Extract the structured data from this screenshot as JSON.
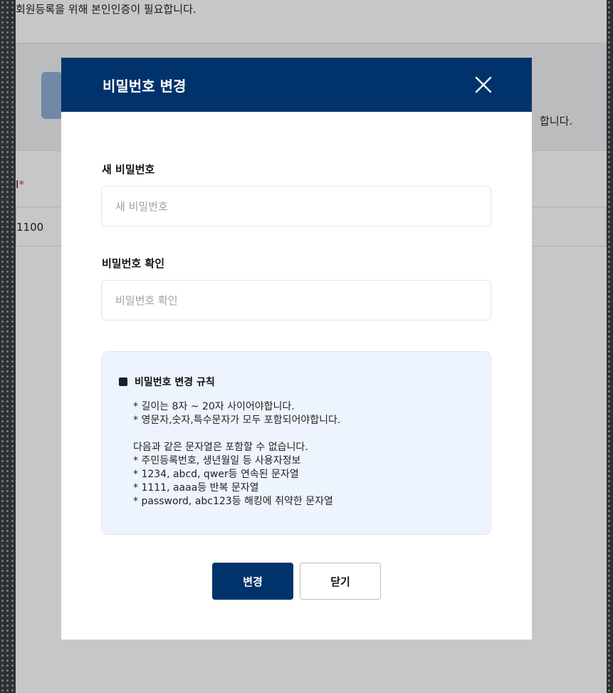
{
  "background": {
    "notice": "회원등록을 위해 본인인증이 필요합니다.",
    "box_text": "합니다.",
    "field_label": "I",
    "required_mark": "*",
    "field_value": "1100"
  },
  "modal": {
    "title": "비밀번호 변경",
    "close_icon": "close-icon",
    "new_password": {
      "label": "새 비밀번호",
      "placeholder": "새 비밀번호",
      "value": ""
    },
    "confirm_password": {
      "label": "비밀번호 확인",
      "placeholder": "비밀번호 확인",
      "value": ""
    },
    "rules": {
      "title": "비밀번호 변경 규칙",
      "lines_a": [
        "* 길이는 8자 ~ 20자 사이어야합니다.",
        "* 영문자,숫자,특수문자가 모두 포함되어야합니다."
      ],
      "lines_b": [
        "다음과 같은 문자열은 포함할 수 없습니다.",
        "* 주민등록번호, 생년월일 등 사용자정보",
        "* 1234, abcd, qwer등 연속된 문자열",
        "* 1111, aaaa등 반복 문자열",
        "* password, abc123등 해킹에 취약한 문자열"
      ]
    },
    "buttons": {
      "submit": "변경",
      "close": "닫기"
    }
  },
  "colors": {
    "primary": "#00336b",
    "rules_bg": "#eef4fd"
  }
}
